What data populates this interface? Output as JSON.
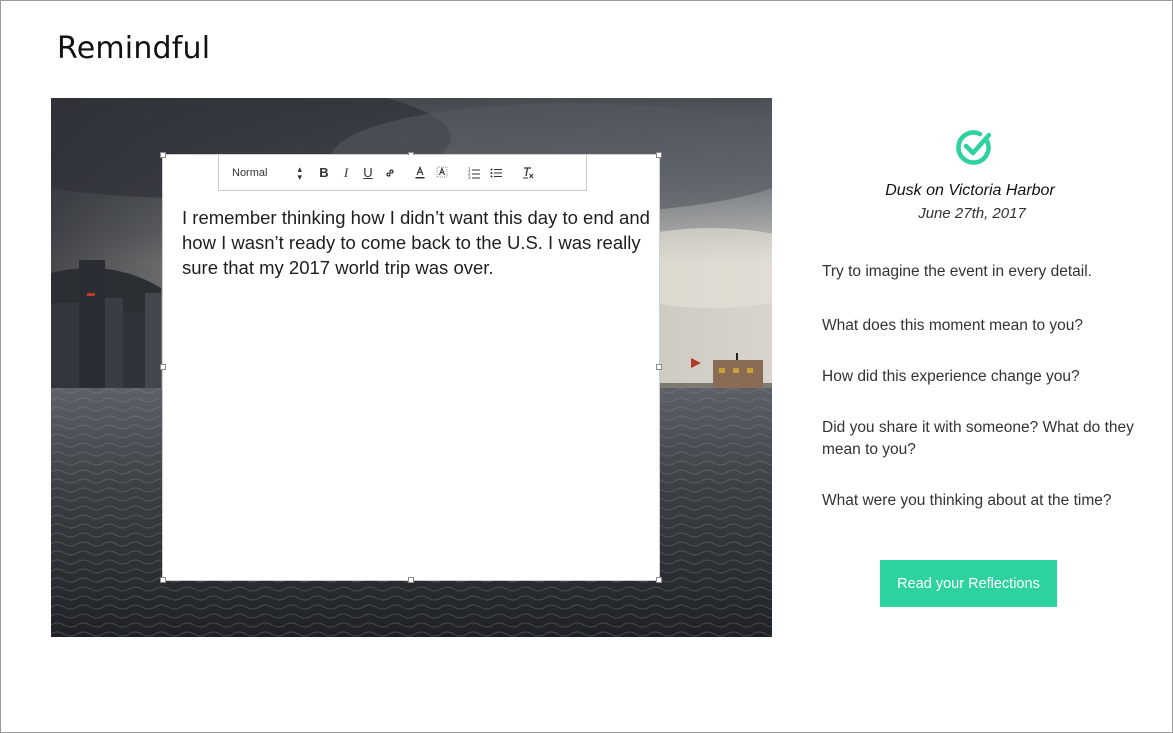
{
  "app": {
    "title": "Remindful"
  },
  "colors": {
    "accent": "#2dd2a0",
    "frame_border": "#9a9a9a"
  },
  "editor": {
    "toolbar": {
      "format_value": "Normal",
      "bold": "B",
      "italic": "I",
      "underline": "U",
      "icons": [
        "link-icon",
        "text-color-icon",
        "background-color-icon",
        "ordered-list-icon",
        "bullet-list-icon",
        "clear-format-icon"
      ]
    },
    "content": "I remember thinking how I didn’t want this day to end and how I wasn’t ready to come back to the U.S. I was really sure that my 2017 world trip was over."
  },
  "moment": {
    "title": "Dusk on Victoria Harbor",
    "date": "June 27th, 2017"
  },
  "prompts": [
    "Try to imagine the event in every detail.",
    "What does this moment mean to you?",
    "How did this experience change you?",
    "Did you share it with someone? What do they mean to you?",
    "What were you thinking about at the time?"
  ],
  "actions": {
    "read_reflections": "Read your Reflections"
  }
}
